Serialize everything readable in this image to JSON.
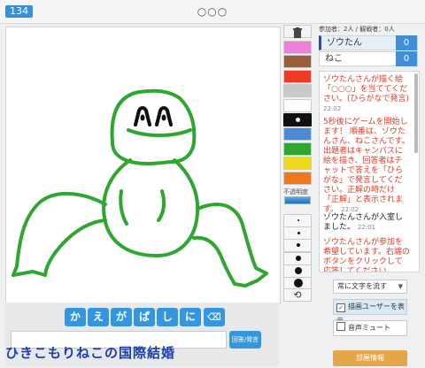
{
  "header": {
    "room_number": "134",
    "topic": "○○○"
  },
  "palette": {
    "colors": [
      "#f07fdb",
      "#9a5f3a",
      "#f03a22",
      "#c8c8c8",
      "#ffffff",
      "#111111",
      "#4a8ad8",
      "#2fa62f",
      "#f0d81a",
      "#f07818"
    ],
    "selected_color": "#111111",
    "brush_sizes": [
      1,
      2,
      3,
      5,
      7,
      9
    ],
    "opacity_label": "不透明度",
    "opacity_value": 1.0
  },
  "drawing": {
    "stroke_color": "#2fa62f"
  },
  "answer_bar": {
    "kana": [
      "か",
      "え",
      "が",
      "ぱ",
      "し",
      "に"
    ],
    "backspace_icon": "backspace-icon",
    "input_value": "",
    "submit_label": "回答/発言"
  },
  "watermark": "ひきこもりねこの国際結婚",
  "sidebar": {
    "counts": "参加者：2人 / 観戦者：0人",
    "players": [
      {
        "name": "ゾウたん",
        "score": "0",
        "active": true
      },
      {
        "name": "ねこ",
        "score": "0",
        "active": false
      }
    ],
    "chat": [
      {
        "text": "ゾウたんさんが描く絵「○○○」を当ててください。(ひらがなで発言)",
        "time": "22:02",
        "color": "red"
      },
      {
        "text": "5秒後にゲームを開始します！ 順番は、ゾウたんさん、ねこさんです。出題者はキャンバスに絵を描き、回答者はチャットで答えを「ひらがな」で発言してください。正解の時だけ「正解」と表示されます。",
        "time": "22:02",
        "color": "red"
      },
      {
        "text": "ゾウたんさんが入室しました。",
        "time": "22:01",
        "color": "black"
      },
      {
        "text": "ゾウたんさんが参加を希望しています。右端のボタンをクリックして応答してください",
        "time": "",
        "color": "red"
      }
    ],
    "flow_select": "常に文字を流す",
    "show_drawer_label": "描画ユーザーを表示",
    "show_drawer_checked": true,
    "mute_label": "音声ミュート",
    "mute_checked": false,
    "room_info_label": "部屋情報"
  }
}
